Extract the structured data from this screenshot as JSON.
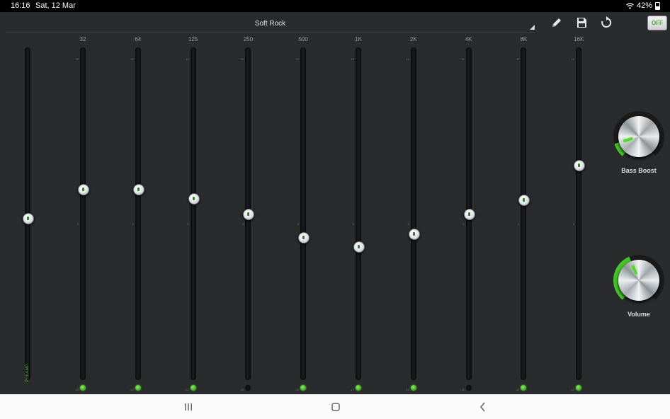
{
  "status_bar": {
    "time": "16:16",
    "date": "Sat, 12 Mar",
    "battery": "42%",
    "wifi_icon": "wifi-icon"
  },
  "toolbar": {
    "preset": "Soft Rock",
    "power_label": "OFF",
    "icons": [
      "edit-icon",
      "save-icon",
      "reset-icon"
    ]
  },
  "eq": {
    "preamp_label": "PREAMP",
    "scale": {
      "max": "12",
      "mid": "0",
      "min": "-12"
    },
    "preamp_value": -0.3,
    "bands": [
      {
        "freq": "32",
        "value": 1.9,
        "led_on": true
      },
      {
        "freq": "64",
        "value": 1.9,
        "led_on": true
      },
      {
        "freq": "125",
        "value": 1.2,
        "led_on": true
      },
      {
        "freq": "250",
        "value": 0,
        "led_on": false
      },
      {
        "freq": "500",
        "value": -1.8,
        "led_on": true
      },
      {
        "freq": "1K",
        "value": -2.5,
        "led_on": true
      },
      {
        "freq": "2K",
        "value": -1.5,
        "led_on": true
      },
      {
        "freq": "4K",
        "value": 0,
        "led_on": false
      },
      {
        "freq": "8K",
        "value": 1.1,
        "led_on": true
      },
      {
        "freq": "16K",
        "value": 3.7,
        "led_on": true
      }
    ]
  },
  "dials": {
    "bass_boost": {
      "label": "Bass Boost",
      "level": 0.12
    },
    "volume": {
      "label": "Volume",
      "level": 0.42
    }
  },
  "colors": {
    "accent": "#46c42a",
    "background": "#2a2b2d"
  },
  "nav_bar": {
    "icons": [
      "recent-apps-icon",
      "home-icon",
      "back-icon"
    ]
  }
}
